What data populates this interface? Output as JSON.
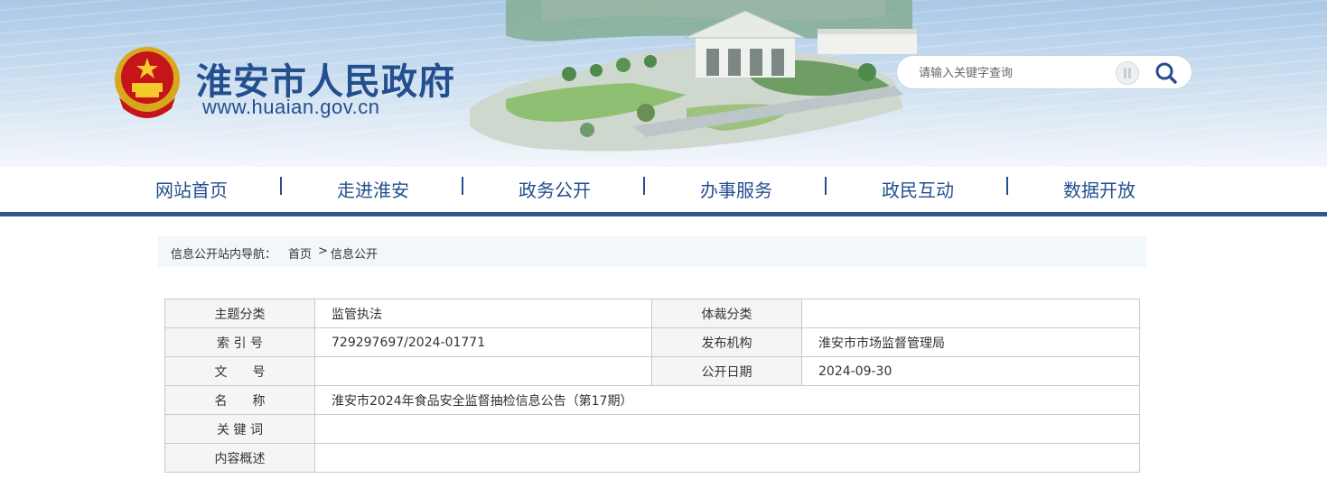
{
  "header": {
    "site_title": "淮安市人民政府",
    "site_url": "www.huaian.gov.cn",
    "search_placeholder": "请输入关键字查询",
    "brand_color": "#244f8f"
  },
  "nav": {
    "items": [
      "网站首页",
      "走进淮安",
      "政务公开",
      "办事服务",
      "政民互动",
      "数据开放"
    ],
    "separator": "|"
  },
  "breadcrumb": {
    "prefix": "信息公开站内导航：",
    "home": "首页",
    "sep": ">",
    "current": "信息公开"
  },
  "info": {
    "topic_label": "主题分类",
    "topic_value": "监管执法",
    "genre_label": "体裁分类",
    "genre_value": "",
    "index_label": "索 引 号",
    "index_value": "729297697/2024-01771",
    "publisher_label": "发布机构",
    "publisher_value": "淮安市市场监督管理局",
    "docno_label": "文　　号",
    "docno_value": "",
    "date_label": "公开日期",
    "date_value": "2024-09-30",
    "name_label": "名　　称",
    "name_value": "淮安市2024年食品安全监督抽检信息公告（第17期）",
    "keywords_label": "关 键 词",
    "keywords_value": "",
    "summary_label": "内容概述",
    "summary_value": ""
  }
}
